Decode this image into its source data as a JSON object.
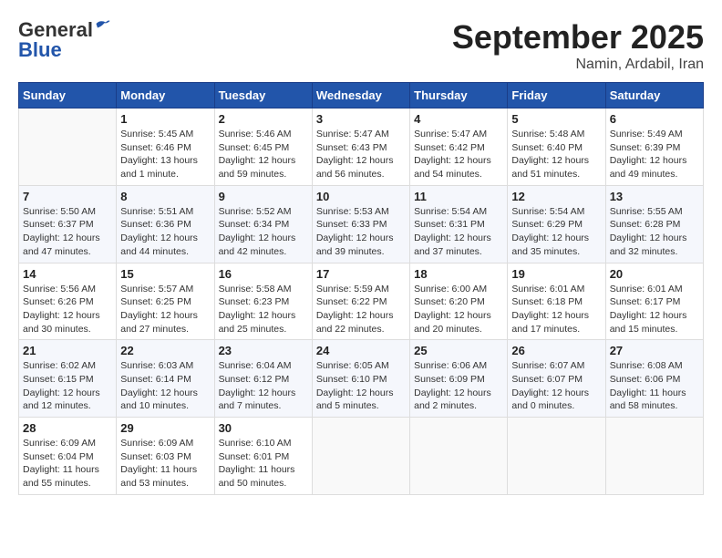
{
  "header": {
    "logo_line1": "General",
    "logo_line2": "Blue",
    "month_title": "September 2025",
    "location": "Namin, Ardabil, Iran"
  },
  "days_of_week": [
    "Sunday",
    "Monday",
    "Tuesday",
    "Wednesday",
    "Thursday",
    "Friday",
    "Saturday"
  ],
  "weeks": [
    [
      {
        "day": "",
        "info": ""
      },
      {
        "day": "1",
        "info": "Sunrise: 5:45 AM\nSunset: 6:46 PM\nDaylight: 13 hours\nand 1 minute."
      },
      {
        "day": "2",
        "info": "Sunrise: 5:46 AM\nSunset: 6:45 PM\nDaylight: 12 hours\nand 59 minutes."
      },
      {
        "day": "3",
        "info": "Sunrise: 5:47 AM\nSunset: 6:43 PM\nDaylight: 12 hours\nand 56 minutes."
      },
      {
        "day": "4",
        "info": "Sunrise: 5:47 AM\nSunset: 6:42 PM\nDaylight: 12 hours\nand 54 minutes."
      },
      {
        "day": "5",
        "info": "Sunrise: 5:48 AM\nSunset: 6:40 PM\nDaylight: 12 hours\nand 51 minutes."
      },
      {
        "day": "6",
        "info": "Sunrise: 5:49 AM\nSunset: 6:39 PM\nDaylight: 12 hours\nand 49 minutes."
      }
    ],
    [
      {
        "day": "7",
        "info": "Sunrise: 5:50 AM\nSunset: 6:37 PM\nDaylight: 12 hours\nand 47 minutes."
      },
      {
        "day": "8",
        "info": "Sunrise: 5:51 AM\nSunset: 6:36 PM\nDaylight: 12 hours\nand 44 minutes."
      },
      {
        "day": "9",
        "info": "Sunrise: 5:52 AM\nSunset: 6:34 PM\nDaylight: 12 hours\nand 42 minutes."
      },
      {
        "day": "10",
        "info": "Sunrise: 5:53 AM\nSunset: 6:33 PM\nDaylight: 12 hours\nand 39 minutes."
      },
      {
        "day": "11",
        "info": "Sunrise: 5:54 AM\nSunset: 6:31 PM\nDaylight: 12 hours\nand 37 minutes."
      },
      {
        "day": "12",
        "info": "Sunrise: 5:54 AM\nSunset: 6:29 PM\nDaylight: 12 hours\nand 35 minutes."
      },
      {
        "day": "13",
        "info": "Sunrise: 5:55 AM\nSunset: 6:28 PM\nDaylight: 12 hours\nand 32 minutes."
      }
    ],
    [
      {
        "day": "14",
        "info": "Sunrise: 5:56 AM\nSunset: 6:26 PM\nDaylight: 12 hours\nand 30 minutes."
      },
      {
        "day": "15",
        "info": "Sunrise: 5:57 AM\nSunset: 6:25 PM\nDaylight: 12 hours\nand 27 minutes."
      },
      {
        "day": "16",
        "info": "Sunrise: 5:58 AM\nSunset: 6:23 PM\nDaylight: 12 hours\nand 25 minutes."
      },
      {
        "day": "17",
        "info": "Sunrise: 5:59 AM\nSunset: 6:22 PM\nDaylight: 12 hours\nand 22 minutes."
      },
      {
        "day": "18",
        "info": "Sunrise: 6:00 AM\nSunset: 6:20 PM\nDaylight: 12 hours\nand 20 minutes."
      },
      {
        "day": "19",
        "info": "Sunrise: 6:01 AM\nSunset: 6:18 PM\nDaylight: 12 hours\nand 17 minutes."
      },
      {
        "day": "20",
        "info": "Sunrise: 6:01 AM\nSunset: 6:17 PM\nDaylight: 12 hours\nand 15 minutes."
      }
    ],
    [
      {
        "day": "21",
        "info": "Sunrise: 6:02 AM\nSunset: 6:15 PM\nDaylight: 12 hours\nand 12 minutes."
      },
      {
        "day": "22",
        "info": "Sunrise: 6:03 AM\nSunset: 6:14 PM\nDaylight: 12 hours\nand 10 minutes."
      },
      {
        "day": "23",
        "info": "Sunrise: 6:04 AM\nSunset: 6:12 PM\nDaylight: 12 hours\nand 7 minutes."
      },
      {
        "day": "24",
        "info": "Sunrise: 6:05 AM\nSunset: 6:10 PM\nDaylight: 12 hours\nand 5 minutes."
      },
      {
        "day": "25",
        "info": "Sunrise: 6:06 AM\nSunset: 6:09 PM\nDaylight: 12 hours\nand 2 minutes."
      },
      {
        "day": "26",
        "info": "Sunrise: 6:07 AM\nSunset: 6:07 PM\nDaylight: 12 hours\nand 0 minutes."
      },
      {
        "day": "27",
        "info": "Sunrise: 6:08 AM\nSunset: 6:06 PM\nDaylight: 11 hours\nand 58 minutes."
      }
    ],
    [
      {
        "day": "28",
        "info": "Sunrise: 6:09 AM\nSunset: 6:04 PM\nDaylight: 11 hours\nand 55 minutes."
      },
      {
        "day": "29",
        "info": "Sunrise: 6:09 AM\nSunset: 6:03 PM\nDaylight: 11 hours\nand 53 minutes."
      },
      {
        "day": "30",
        "info": "Sunrise: 6:10 AM\nSunset: 6:01 PM\nDaylight: 11 hours\nand 50 minutes."
      },
      {
        "day": "",
        "info": ""
      },
      {
        "day": "",
        "info": ""
      },
      {
        "day": "",
        "info": ""
      },
      {
        "day": "",
        "info": ""
      }
    ]
  ]
}
